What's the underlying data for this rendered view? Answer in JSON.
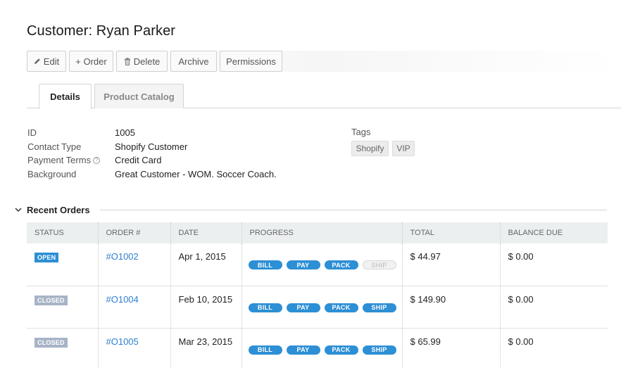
{
  "page": {
    "title": "Customer: Ryan Parker"
  },
  "toolbar": {
    "edit": "Edit",
    "order": "+ Order",
    "delete": "Delete",
    "archive": "Archive",
    "permissions": "Permissions"
  },
  "tabs": {
    "details": "Details",
    "catalog": "Product Catalog"
  },
  "details": {
    "id_label": "ID",
    "id_value": "1005",
    "contact_label": "Contact Type",
    "contact_value": "Shopify Customer",
    "payment_label": "Payment Terms",
    "payment_value": "Credit Card",
    "background_label": "Background",
    "background_value": "Great Customer - WOM. Soccer Coach."
  },
  "tags": {
    "label": "Tags",
    "items": [
      "Shopify",
      "VIP"
    ]
  },
  "orders": {
    "section_title": "Recent Orders",
    "headers": [
      "STATUS",
      "ORDER #",
      "DATE",
      "PROGRESS",
      "TOTAL",
      "BALANCE DUE"
    ],
    "rows": [
      {
        "status": "OPEN",
        "order": "#O1002",
        "date": "Apr 1, 2015",
        "bill": "BILL",
        "pay": "PAY",
        "pack": "PACK",
        "ship": "SHIP",
        "total": "$ 44.97",
        "balance": "$ 0.00"
      },
      {
        "status": "CLOSED",
        "order": "#O1004",
        "date": "Feb 10, 2015",
        "bill": "BILL",
        "pay": "PAY",
        "pack": "PACK",
        "ship": "SHIP",
        "total": "$ 149.90",
        "balance": "$ 0.00"
      },
      {
        "status": "CLOSED",
        "order": "#O1005",
        "date": "Mar 23, 2015",
        "bill": "BILL",
        "pay": "PAY",
        "pack": "PACK",
        "ship": "SHIP",
        "total": "$ 65.99",
        "balance": "$ 0.00"
      }
    ]
  },
  "colors": {
    "accent": "#2d8fd5",
    "closed": "#a7b4c6",
    "link": "#2d7fcf"
  },
  "icons": {
    "edit": "pencil-icon",
    "delete": "trash-icon",
    "help": "question-circle-icon",
    "collapse": "chevron-down-icon"
  }
}
